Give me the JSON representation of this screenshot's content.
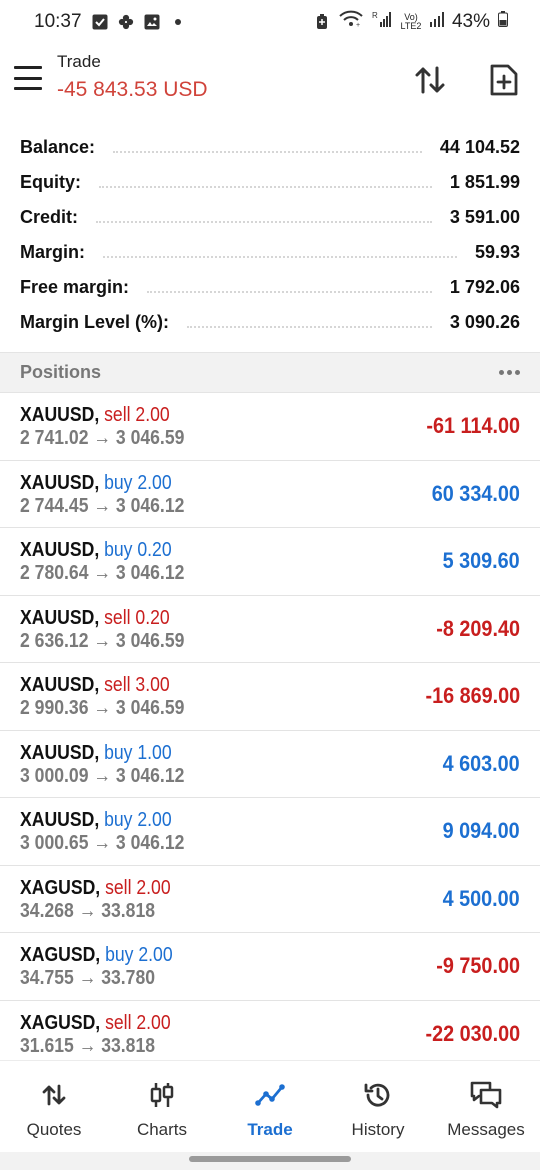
{
  "status_bar": {
    "time": "10:37",
    "battery": "43%",
    "network": "Vo) LTE2"
  },
  "header": {
    "title": "Trade",
    "balance_change": "-45 843.53 USD"
  },
  "summary": [
    {
      "label": "Balance:",
      "value": "44 104.52"
    },
    {
      "label": "Equity:",
      "value": "1 851.99"
    },
    {
      "label": "Credit:",
      "value": "3 591.00"
    },
    {
      "label": "Margin:",
      "value": "59.93"
    },
    {
      "label": "Free margin:",
      "value": "1 792.06"
    },
    {
      "label": "Margin Level (%):",
      "value": "3 090.26"
    }
  ],
  "positions_section": {
    "title": "Positions"
  },
  "positions": [
    {
      "symbol": "XAUUSD,",
      "side": "sell 2.00",
      "type": "sell",
      "prices": "2 741.02 → 3 046.59",
      "profit": "-61 114.00",
      "profit_sign": "neg"
    },
    {
      "symbol": "XAUUSD,",
      "side": "buy 2.00",
      "type": "buy",
      "prices": "2 744.45 → 3 046.12",
      "profit": "60 334.00",
      "profit_sign": "pos"
    },
    {
      "symbol": "XAUUSD,",
      "side": "buy 0.20",
      "type": "buy",
      "prices": "2 780.64 → 3 046.12",
      "profit": "5 309.60",
      "profit_sign": "pos"
    },
    {
      "symbol": "XAUUSD,",
      "side": "sell 0.20",
      "type": "sell",
      "prices": "2 636.12 → 3 046.59",
      "profit": "-8 209.40",
      "profit_sign": "neg"
    },
    {
      "symbol": "XAUUSD,",
      "side": "sell 3.00",
      "type": "sell",
      "prices": "2 990.36 → 3 046.59",
      "profit": "-16 869.00",
      "profit_sign": "neg"
    },
    {
      "symbol": "XAUUSD,",
      "side": "buy 1.00",
      "type": "buy",
      "prices": "3 000.09 → 3 046.12",
      "profit": "4 603.00",
      "profit_sign": "pos"
    },
    {
      "symbol": "XAUUSD,",
      "side": "buy 2.00",
      "type": "buy",
      "prices": "3 000.65 → 3 046.12",
      "profit": "9 094.00",
      "profit_sign": "pos"
    },
    {
      "symbol": "XAGUSD,",
      "side": "sell 2.00",
      "type": "sell",
      "prices": "34.268 → 33.818",
      "profit": "4 500.00",
      "profit_sign": "pos"
    },
    {
      "symbol": "XAGUSD,",
      "side": "buy 2.00",
      "type": "buy",
      "prices": "34.755 → 33.780",
      "profit": "-9 750.00",
      "profit_sign": "neg"
    },
    {
      "symbol": "XAGUSD,",
      "side": "sell 2.00",
      "type": "sell",
      "prices": "31.615 → 33.818",
      "profit": "-22 030.00",
      "profit_sign": "neg"
    }
  ],
  "nav": [
    {
      "label": "Quotes",
      "icon": "quotes-icon"
    },
    {
      "label": "Charts",
      "icon": "charts-icon"
    },
    {
      "label": "Trade",
      "icon": "trade-icon",
      "active": true
    },
    {
      "label": "History",
      "icon": "history-icon"
    },
    {
      "label": "Messages",
      "icon": "messages-icon"
    }
  ],
  "colors": {
    "sell": "#c81e1e",
    "buy": "#1c6fd1",
    "header_balance": "#d0433a",
    "active_nav": "#1c6fd1"
  }
}
